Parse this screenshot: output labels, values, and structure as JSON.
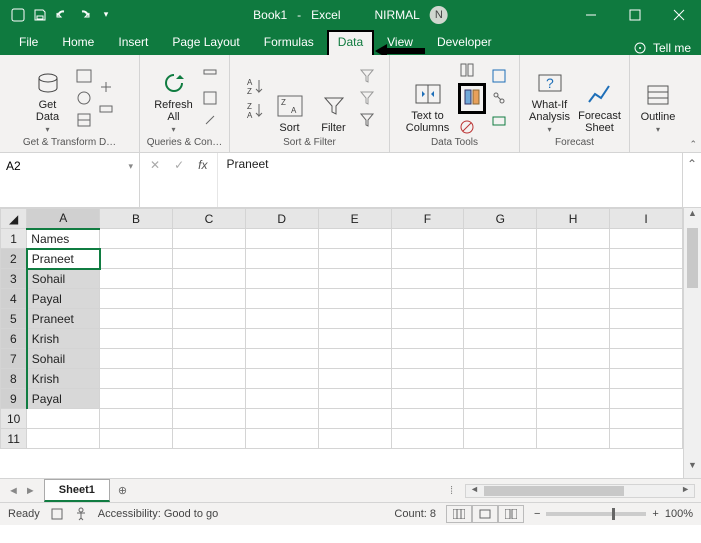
{
  "title": {
    "book": "Book1",
    "app": "Excel",
    "user": "NIRMAL",
    "avatar_initial": "N"
  },
  "tabs": {
    "file": "File",
    "home": "Home",
    "insert": "Insert",
    "page_layout": "Page Layout",
    "formulas": "Formulas",
    "data": "Data",
    "view": "View",
    "developer": "Developer",
    "tell_me": "Tell me"
  },
  "ribbon": {
    "get_data": "Get\nData",
    "refresh_all": "Refresh\nAll",
    "sort": "Sort",
    "filter": "Filter",
    "text_to_columns": "Text to\nColumns",
    "what_if": "What-If\nAnalysis",
    "forecast_sheet": "Forecast\nSheet",
    "outline": "Outline",
    "groups": {
      "get_transform": "Get & Transform D…",
      "queries": "Queries & Con…",
      "sort_filter": "Sort & Filter",
      "data_tools": "Data Tools",
      "forecast": "Forecast"
    }
  },
  "formula_bar": {
    "name_box": "A2",
    "fx": "fx",
    "value": "Praneet"
  },
  "columns": [
    "A",
    "B",
    "C",
    "D",
    "E",
    "F",
    "G",
    "H",
    "I"
  ],
  "rows": [
    {
      "n": 1,
      "a": "Names"
    },
    {
      "n": 2,
      "a": "Praneet"
    },
    {
      "n": 3,
      "a": "Sohail"
    },
    {
      "n": 4,
      "a": "Payal"
    },
    {
      "n": 5,
      "a": "Praneet"
    },
    {
      "n": 6,
      "a": "Krish"
    },
    {
      "n": 7,
      "a": "Sohail"
    },
    {
      "n": 8,
      "a": "Krish"
    },
    {
      "n": 9,
      "a": "Payal"
    },
    {
      "n": 10,
      "a": ""
    },
    {
      "n": 11,
      "a": ""
    }
  ],
  "sheet_tab": "Sheet1",
  "status": {
    "ready": "Ready",
    "accessibility": "Accessibility: Good to go",
    "count": "Count: 8",
    "zoom": "100%"
  }
}
